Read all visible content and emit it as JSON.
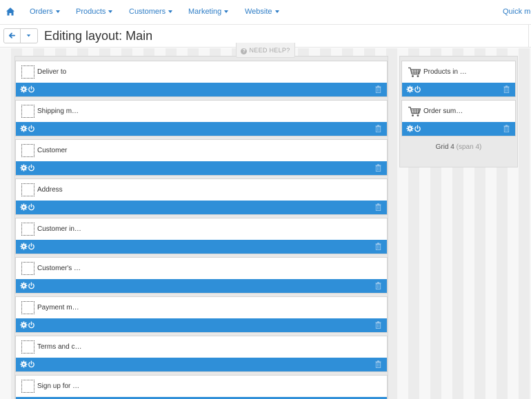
{
  "nav": {
    "items": [
      {
        "label": "Orders"
      },
      {
        "label": "Products"
      },
      {
        "label": "Customers"
      },
      {
        "label": "Marketing"
      },
      {
        "label": "Website"
      }
    ],
    "quick_menu_label": "Quick me"
  },
  "header": {
    "title": "Editing layout: Main"
  },
  "help": {
    "label": "NEED HELP?"
  },
  "main_blocks": [
    {
      "title": "Deliver to"
    },
    {
      "title": "Shipping m…"
    },
    {
      "title": "Customer"
    },
    {
      "title": "Address"
    },
    {
      "title": "Customer in…"
    },
    {
      "title": "Customer's …"
    },
    {
      "title": "Payment m…"
    },
    {
      "title": "Terms and c…"
    },
    {
      "title": "Sign up for …"
    }
  ],
  "side_blocks": [
    {
      "title": "Products in …"
    },
    {
      "title": "Order sum…"
    }
  ],
  "side_grid": {
    "label": "Grid 4",
    "span": "(span 4)"
  },
  "colors": {
    "accent": "#2f8fd8",
    "link": "#2e7dc6"
  },
  "icons": {
    "home": "home-icon",
    "back": "arrow-left-icon",
    "dropdown": "caret-down-icon",
    "settings": "gear-icon",
    "power": "power-icon",
    "delete": "trash-icon",
    "cart": "cart-icon",
    "placeholder": "dotted-square-icon"
  }
}
